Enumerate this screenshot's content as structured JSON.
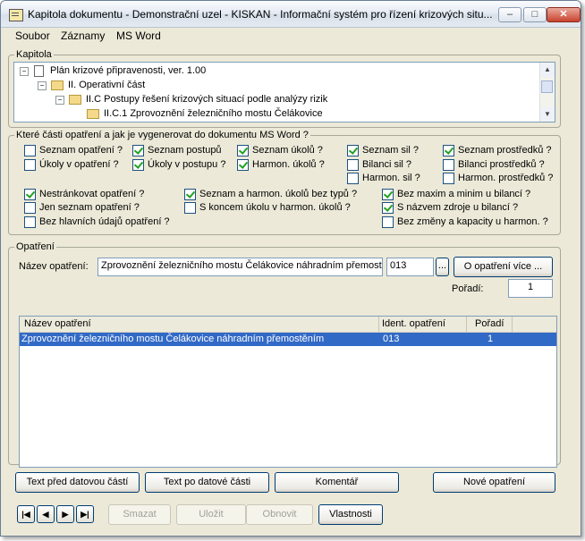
{
  "window": {
    "title": "Kapitola dokumentu - Demonstrační uzel - KISKAN - Informační systém pro řízení krizových situ...",
    "min_label": "–",
    "max_label": "□",
    "close_label": "✕"
  },
  "menu": [
    "Soubor",
    "Záznamy",
    "MS Word"
  ],
  "kapitola": {
    "legend": "Kapitola",
    "tree": [
      {
        "toggle": "−",
        "icon": "document-icon",
        "label": "Plán krizové připravenosti, ver. 1.00"
      },
      {
        "toggle": "−",
        "icon": "folder-icon",
        "label": "II. Operativní část"
      },
      {
        "toggle": "−",
        "icon": "folder-icon",
        "label": "II.C Postupy řešení krizových situací podle analýzy rizik"
      },
      {
        "toggle": "",
        "icon": "folder-icon",
        "label": "II.C.1 Zprovoznění železničního mostu Čelákovice"
      }
    ]
  },
  "parts": {
    "legend": "Které části opatření a jak je vygenerovat do dokumentu MS Word ?",
    "checkboxes": [
      {
        "label": "Seznam opatření ?",
        "checked": false
      },
      {
        "label": "Seznam postupů",
        "checked": true
      },
      {
        "label": "Seznam úkolů ?",
        "checked": true
      },
      {
        "label": "Seznam sil ?",
        "checked": true
      },
      {
        "label": "Seznam prostředků ?",
        "checked": true
      },
      {
        "label": "Úkoly v opatření ?",
        "checked": false
      },
      {
        "label": "Úkoly v postupu ?",
        "checked": true
      },
      {
        "label": "Harmon. úkolů ?",
        "checked": true
      },
      {
        "label": "Bilanci sil ?",
        "checked": false
      },
      {
        "label": "Bilanci prostředků ?",
        "checked": false
      },
      {
        "label": "Harmon. sil ?",
        "checked": false
      },
      {
        "label": "Harmon. prostředků ?",
        "checked": false
      },
      {
        "label": "Nestránkovat opatření ?",
        "checked": true
      },
      {
        "label": "Seznam a harmon. úkolů bez typů ?",
        "checked": true
      },
      {
        "label": "Bez maxim a minim u bilancí ?",
        "checked": true
      },
      {
        "label": "Jen seznam opatření ?",
        "checked": false
      },
      {
        "label": "S koncem úkolu v harmon. úkolů ?",
        "checked": false
      },
      {
        "label": "S názvem zdroje u bilancí ?",
        "checked": true
      },
      {
        "label": "Bez hlavních údajů opatření ?",
        "checked": false
      },
      {
        "label": "Bez změny a kapacity u harmon. ?",
        "checked": false
      }
    ]
  },
  "opatreni": {
    "legend": "Opatření",
    "name_label": "Název opatření:",
    "name_value": "Zprovoznění železničního mostu Čelákovice náhradním přemostěním",
    "code_value": "013",
    "browse_label": "...",
    "more_label": "O opatření více ...",
    "order_label": "Pořadí:",
    "order_value": "1",
    "table": {
      "headers": [
        "Název opatření",
        "Ident. opatření",
        "Pořadí"
      ],
      "rows": [
        [
          "Zprovoznění železničního mostu Čelákovice náhradním přemostěním",
          "013",
          "1"
        ]
      ]
    }
  },
  "buttons": {
    "text_before": "Text před datovou částí",
    "text_after": "Text po datové části",
    "comment": "Komentář",
    "new": "Nové opatření",
    "delete": "Smazat",
    "save": "Uložit",
    "restore": "Obnovit",
    "properties": "Vlastnosti"
  },
  "nav": [
    "|◀",
    "◀",
    "▶",
    "▶|"
  ],
  "colors": {
    "selection": "#3169c6",
    "check": "#21a121",
    "window_bg": "#ece9d8"
  }
}
